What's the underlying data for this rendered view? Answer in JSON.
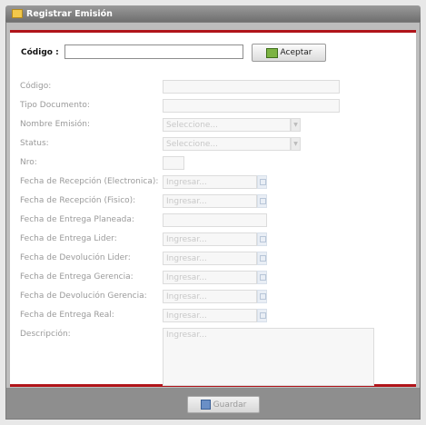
{
  "window": {
    "title": "Registrar Emisión"
  },
  "search": {
    "label": "Código :",
    "value": "",
    "button": "Aceptar"
  },
  "form": {
    "codigo": {
      "label": "Código:",
      "value": ""
    },
    "tipo_documento": {
      "label": "Tipo Documento:",
      "value": ""
    },
    "nombre_emision": {
      "label": "Nombre Emisión:",
      "placeholder": "Seleccione..."
    },
    "status": {
      "label": "Status:",
      "placeholder": "Seleccione..."
    },
    "nro": {
      "label": "Nro:",
      "value": ""
    },
    "fecha_recepcion_electronica": {
      "label": "Fecha de Recepción (Electronica):",
      "placeholder": "Ingresar..."
    },
    "fecha_recepcion_fisico": {
      "label": "Fecha de Recepción (Fisico):",
      "placeholder": "Ingresar..."
    },
    "fecha_entrega_planeada": {
      "label": "Fecha de Entrega Planeada:",
      "value": ""
    },
    "fecha_entrega_lider": {
      "label": "Fecha de Entrega Lider:",
      "placeholder": "Ingresar..."
    },
    "fecha_devolucion_lider": {
      "label": "Fecha de Devolución Lider:",
      "placeholder": "Ingresar..."
    },
    "fecha_entrega_gerencia": {
      "label": "Fecha de Entrega Gerencia:",
      "placeholder": "Ingresar..."
    },
    "fecha_devolucion_gerencia": {
      "label": "Fecha de Devolución Gerencia:",
      "placeholder": "Ingresar..."
    },
    "fecha_entrega_real": {
      "label": "Fecha de Entrega Real:",
      "placeholder": "Ingresar..."
    },
    "descripcion": {
      "label": "Descripción:",
      "placeholder": "Ingresar..."
    }
  },
  "footer": {
    "save_button": "Guardar"
  },
  "icons": {
    "window": "folder-icon",
    "accept": "accept-icon",
    "save": "save-icon",
    "calendar": "calendar-icon",
    "dropdown": "chevron-down-icon"
  },
  "colors": {
    "accent_red": "#b0141a",
    "title_bar": "#7a7a7a"
  }
}
